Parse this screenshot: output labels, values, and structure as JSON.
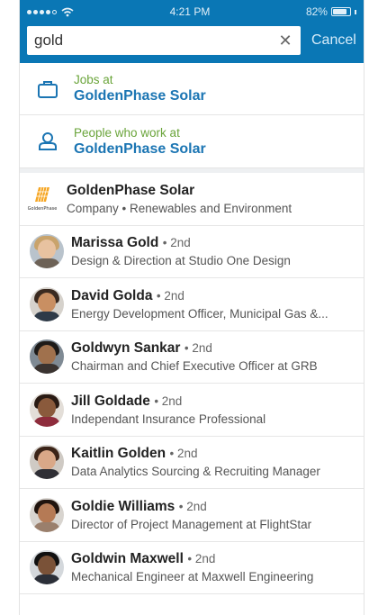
{
  "status_bar": {
    "time": "4:21 PM",
    "battery_percent": "82%",
    "battery_level": 0.82,
    "signal_dots": 5,
    "signal_filled": 4
  },
  "search": {
    "value": "gold",
    "cancel_label": "Cancel",
    "clear_icon": "close-icon"
  },
  "suggestions": [
    {
      "icon": "briefcase-icon",
      "prefix": "Jobs at",
      "company": "GoldenPhase Solar"
    },
    {
      "icon": "person-icon",
      "prefix": "People who work at",
      "company": "GoldenPhase Solar"
    }
  ],
  "company_result": {
    "name": "GoldenPhase Solar",
    "subtitle": "Company • Renewables and Environment",
    "logo_text": "GoldenPhase"
  },
  "people": [
    {
      "name": "Marissa Gold",
      "degree": "• 2nd",
      "headline": "Design & Direction at Studio One Design"
    },
    {
      "name": "David Golda",
      "degree": "• 2nd",
      "headline": "Energy Development Officer, Municipal Gas &..."
    },
    {
      "name": "Goldwyn Sankar",
      "degree": "• 2nd",
      "headline": "Chairman and Chief Executive Officer at GRB"
    },
    {
      "name": "Jill Goldade",
      "degree": "• 2nd",
      "headline": "Independant Insurance Professional"
    },
    {
      "name": "Kaitlin Golden",
      "degree": "• 2nd",
      "headline": "Data Analytics Sourcing & Recruiting Manager"
    },
    {
      "name": "Goldie Williams",
      "degree": "• 2nd",
      "headline": "Director of Project Management at FlightStar"
    },
    {
      "name": "Goldwin Maxwell",
      "degree": "• 2nd",
      "headline": "Mechanical Engineer at Maxwell Engineering"
    }
  ],
  "colors": {
    "header": "#0a77b5",
    "link_blue": "#1b75b3",
    "suggest_green": "#6aa43a"
  }
}
